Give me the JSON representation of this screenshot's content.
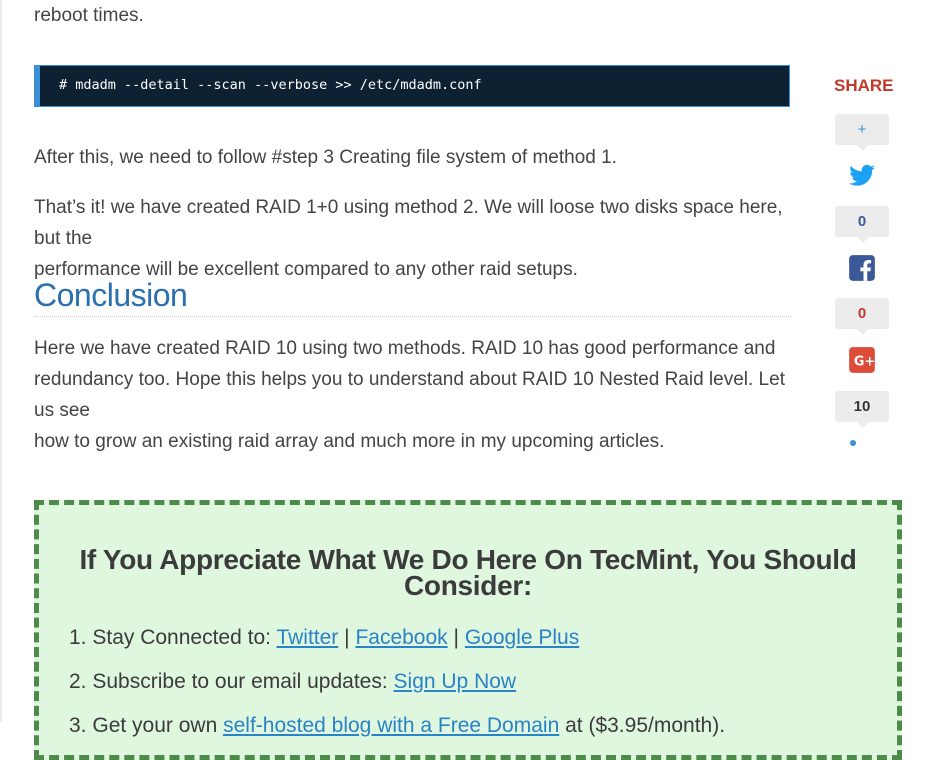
{
  "article": {
    "intro_tail": "reboot times.",
    "code": "# mdadm --detail --scan --verbose >> /etc/mdadm.conf",
    "para_follow": "After this, we need to follow #step 3 Creating file system of method 1.",
    "para_done_line1": "That’s it! we have created RAID 1+0 using method 2. We will loose two disks space here, but the",
    "para_done_line2": "performance will be excellent compared to any other raid setups.",
    "heading": "Conclusion",
    "conclusion_line1": "Here we have created RAID 10 using two methods. RAID 10 has good performance and",
    "conclusion_line2": "redundancy too. Hope this helps you to understand about RAID 10 Nested Raid level. Let us see",
    "conclusion_line3": "how to grow an existing raid array and much more in my upcoming articles."
  },
  "share": {
    "title": "SHARE",
    "plus_label": "+",
    "twitter_count": "0",
    "facebook_count": "0",
    "googleplus_count": "10",
    "colors": {
      "twitter": "#1da1f2",
      "facebook": "#3b5998",
      "googleplus": "#dd4b39"
    }
  },
  "appreciate": {
    "title": "If You Appreciate What We Do Here On TecMint, You Should Consider:",
    "items": [
      {
        "num": "1.",
        "text": "Stay Connected to: ",
        "links": [
          "Twitter",
          "Facebook",
          "Google Plus"
        ],
        "sep": "|"
      },
      {
        "num": "2.",
        "text": "Subscribe to our email updates: ",
        "link": "Sign Up Now"
      },
      {
        "num": "3.",
        "text": "Get your own ",
        "link": "self-hosted blog with a Free Domain",
        "tail": " at ($3.95/month)."
      }
    ]
  }
}
